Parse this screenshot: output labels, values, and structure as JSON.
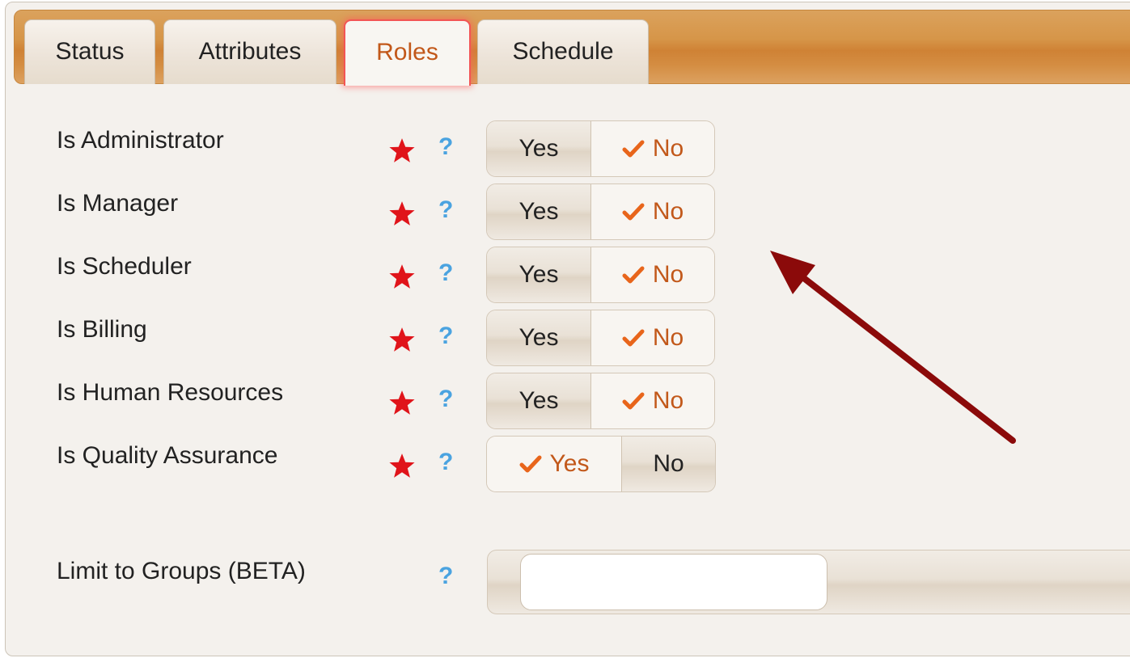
{
  "tabs": [
    {
      "label": "Status",
      "active": false
    },
    {
      "label": "Attributes",
      "active": false
    },
    {
      "label": "Roles",
      "active": true
    },
    {
      "label": "Schedule",
      "active": false
    }
  ],
  "roles": [
    {
      "label": "Is Administrator",
      "yes": "Yes",
      "no": "No",
      "selected": "No"
    },
    {
      "label": "Is Manager",
      "yes": "Yes",
      "no": "No",
      "selected": "No"
    },
    {
      "label": "Is Scheduler",
      "yes": "Yes",
      "no": "No",
      "selected": "No"
    },
    {
      "label": "Is Billing",
      "yes": "Yes",
      "no": "No",
      "selected": "No"
    },
    {
      "label": "Is Human Resources",
      "yes": "Yes",
      "no": "No",
      "selected": "No"
    },
    {
      "label": "Is Quality Assurance",
      "yes": "Yes",
      "no": "No",
      "selected": "Yes"
    }
  ],
  "help_glyph": "?",
  "groups": {
    "label": "Limit to Groups (BETA)",
    "value": ""
  },
  "colors": {
    "accent": "#c2581a",
    "required_star": "#e0141a",
    "help": "#4aa3e0",
    "tab_bar": "#d69548",
    "annotation_arrow": "#8b0a0a"
  },
  "icons": {
    "required": "star-icon",
    "selected": "check-icon",
    "help": "question-icon"
  }
}
